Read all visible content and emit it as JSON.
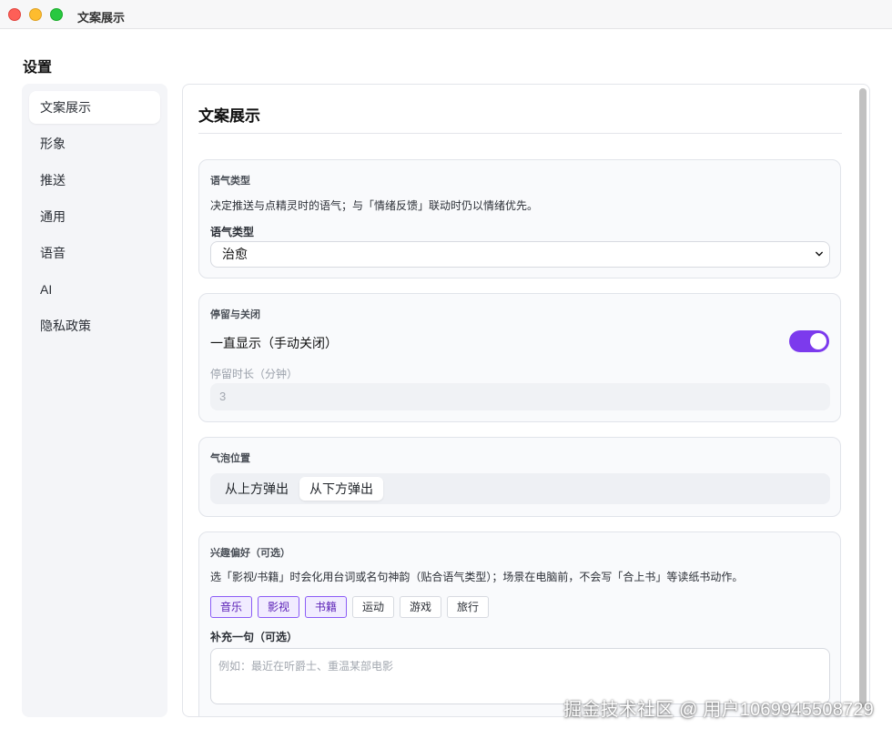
{
  "window": {
    "title": "文案展示"
  },
  "page_title": "设置",
  "sidebar": {
    "items": [
      {
        "label": "文案展示",
        "active": true
      },
      {
        "label": "形象",
        "active": false
      },
      {
        "label": "推送",
        "active": false
      },
      {
        "label": "通用",
        "active": false
      },
      {
        "label": "语音",
        "active": false
      },
      {
        "label": "AI",
        "active": false
      },
      {
        "label": "隐私政策",
        "active": false
      }
    ]
  },
  "main": {
    "title": "文案展示",
    "tone": {
      "title": "语气类型",
      "desc": "决定推送与点精灵时的语气；与「情绪反馈」联动时仍以情绪优先。",
      "label": "语气类型",
      "selected": "治愈"
    },
    "stay": {
      "title": "停留与关闭",
      "toggle_label": "一直显示（手动关闭）",
      "toggle_on": true,
      "duration_label": "停留时长（分钟）",
      "duration_value": "3"
    },
    "bubble": {
      "title": "气泡位置",
      "options": [
        "从上方弹出",
        "从下方弹出"
      ],
      "selected": "从下方弹出"
    },
    "interests": {
      "title": "兴趣偏好（可选）",
      "desc": "选「影视/书籍」时会化用台词或名句神韵（贴合语气类型）；场景在电脑前，不会写「合上书」等读纸书动作。",
      "chips": [
        {
          "label": "音乐",
          "selected": true
        },
        {
          "label": "影视",
          "selected": true
        },
        {
          "label": "书籍",
          "selected": true
        },
        {
          "label": "运动",
          "selected": false
        },
        {
          "label": "游戏",
          "selected": false
        },
        {
          "label": "旅行",
          "selected": false
        }
      ],
      "extra_label": "补充一句（可选）",
      "extra_placeholder": "例如：最近在听爵士、重温某部电影"
    }
  },
  "watermark": "掘金技术社区 @ 用户1069945508729",
  "colors": {
    "accent": "#7c3aed",
    "chip_selected_bg": "#f1ecff"
  }
}
